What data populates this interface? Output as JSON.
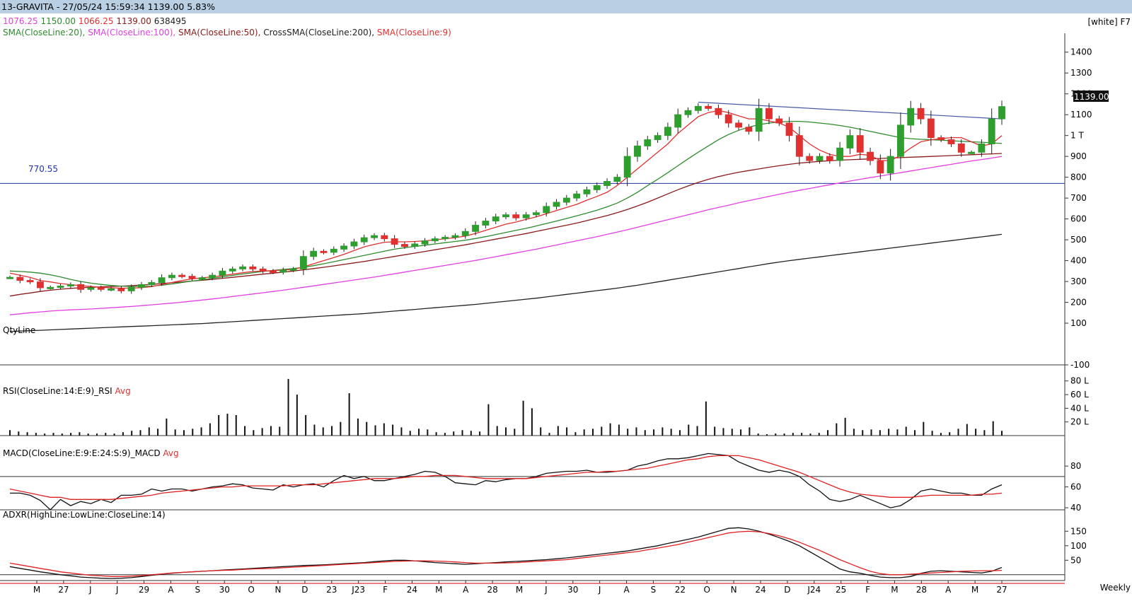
{
  "title_bar": "13-GRAVITA - 27/05/24 15:59:34 1139.00 5.83%",
  "theme_label": "[white] F7",
  "ohlc_line": {
    "open": "1076.25",
    "high": "1150.00",
    "low": "1066.25",
    "close": "1139.00",
    "volume": "638495"
  },
  "indicator_legend": [
    {
      "text": "SMA(CloseLine:20),",
      "color": "#2e8b2e"
    },
    {
      "text": "SMA(CloseLine:100),",
      "color": "#e040e0"
    },
    {
      "text": "SMA(CloseLine:50),",
      "color": "#8b1a1a"
    },
    {
      "text": "CrossSMA(CloseLine:200),",
      "color": "#222222"
    },
    {
      "text": "SMA(CloseLine:9)",
      "color": "#e03030"
    }
  ],
  "horizontal_line_label": "770.55",
  "last_price_label": "1139.00",
  "qty_label": "QtyLine",
  "rsi_label": "RSI(CloseLine:14:E:9)_RSI",
  "rsi_avg": "Avg",
  "macd_label": "MACD(CloseLine:E:9:E:24:S:9)_MACD",
  "macd_avg": "Avg",
  "adxr_label": "ADXR(HighLine:LowLine:CloseLine:14)",
  "period_label": "Weekly",
  "colors": {
    "up": "#2e9e2e",
    "down": "#e03030",
    "sma20": "#2e8b2e",
    "sma100": "#e040e0",
    "sma50": "#8b1a1a",
    "sma200": "#222222",
    "sma9": "#e03030",
    "trendline": "#4a5aa8",
    "hline": "#2233aa",
    "titlebar": "#b9cfe4"
  },
  "chart_data": [
    {
      "type": "candlestick",
      "ylim": [
        -100,
        1450
      ],
      "yticks": [
        "1400",
        "1300",
        "1200",
        "1100",
        "1 T",
        "900",
        "800",
        "700",
        "600",
        "500",
        "400",
        "300",
        "200",
        "100",
        "-100"
      ],
      "ytick_values": [
        1400,
        1300,
        1200,
        1100,
        1000,
        900,
        800,
        700,
        600,
        500,
        400,
        300,
        200,
        100,
        -100
      ],
      "xticks": [
        "M",
        "27",
        "J",
        "J",
        "29",
        "A",
        "S",
        "30",
        "O",
        "N",
        "D",
        "23",
        "J23",
        "F",
        "24",
        "M",
        "A",
        "28",
        "M",
        "J",
        "30",
        "J",
        "A",
        "S",
        "22",
        "O",
        "N",
        "24",
        "D",
        "J24",
        "25",
        "F",
        "M",
        "28",
        "A",
        "M",
        "27"
      ],
      "horizontal_line": 770.55,
      "close": [
        320,
        305,
        298,
        270,
        272,
        278,
        285,
        262,
        270,
        262,
        265,
        255,
        272,
        285,
        295,
        318,
        330,
        325,
        315,
        318,
        330,
        350,
        360,
        370,
        360,
        350,
        345,
        355,
        360,
        420,
        445,
        440,
        455,
        470,
        490,
        510,
        520,
        505,
        478,
        468,
        480,
        495,
        505,
        512,
        520,
        540,
        570,
        590,
        610,
        620,
        605,
        620,
        630,
        660,
        680,
        700,
        720,
        740,
        760,
        780,
        800,
        900,
        950,
        980,
        1000,
        1040,
        1100,
        1120,
        1140,
        1130,
        1100,
        1060,
        1040,
        1020,
        1130,
        1080,
        1060,
        1000,
        900,
        880,
        900,
        880,
        940,
        1000,
        920,
        880,
        820,
        900,
        1050,
        1130,
        1080,
        990,
        980,
        960,
        920,
        920,
        960,
        1080,
        1139
      ],
      "sma9": [
        340,
        330,
        320,
        305,
        298,
        290,
        285,
        280,
        276,
        272,
        270,
        268,
        268,
        270,
        275,
        285,
        295,
        305,
        312,
        318,
        322,
        328,
        335,
        342,
        348,
        350,
        352,
        355,
        358,
        370,
        385,
        400,
        415,
        430,
        448,
        466,
        478,
        488,
        490,
        490,
        492,
        495,
        500,
        505,
        510,
        518,
        530,
        545,
        560,
        575,
        585,
        598,
        610,
        625,
        640,
        655,
        670,
        690,
        708,
        728,
        760,
        800,
        840,
        880,
        920,
        960,
        1010,
        1050,
        1090,
        1110,
        1120,
        1110,
        1095,
        1080,
        1080,
        1070,
        1060,
        1040,
        1000,
        960,
        930,
        910,
        900,
        900,
        910,
        905,
        880,
        880,
        905,
        940,
        970,
        980,
        985,
        990,
        990,
        970,
        950,
        960,
        1000
      ],
      "sma20": [
        350,
        348,
        345,
        340,
        332,
        322,
        310,
        300,
        292,
        286,
        281,
        278,
        276,
        276,
        278,
        282,
        288,
        295,
        302,
        308,
        315,
        322,
        329,
        336,
        342,
        348,
        353,
        358,
        362,
        368,
        376,
        385,
        395,
        405,
        415,
        425,
        435,
        445,
        455,
        462,
        468,
        474,
        480,
        486,
        492,
        498,
        506,
        515,
        525,
        535,
        545,
        555,
        566,
        578,
        590,
        602,
        615,
        628,
        642,
        658,
        676,
        700,
        728,
        760,
        790,
        822,
        855,
        888,
        920,
        950,
        980,
        1005,
        1025,
        1040,
        1052,
        1060,
        1065,
        1068,
        1068,
        1065,
        1060,
        1055,
        1048,
        1040,
        1030,
        1020,
        1010,
        1000,
        990,
        985,
        982,
        980,
        978,
        975,
        972,
        970,
        968,
        965,
        962
      ],
      "sma50": [
        230,
        238,
        245,
        252,
        258,
        263,
        267,
        270,
        272,
        274,
        276,
        278,
        280,
        283,
        286,
        290,
        294,
        298,
        302,
        306,
        310,
        315,
        320,
        325,
        330,
        335,
        340,
        345,
        350,
        356,
        362,
        368,
        375,
        382,
        389,
        396,
        404,
        412,
        420,
        428,
        436,
        444,
        452,
        460,
        468,
        476,
        485,
        494,
        503,
        512,
        521,
        530,
        540,
        550,
        560,
        570,
        580,
        592,
        604,
        616,
        630,
        645,
        662,
        680,
        700,
        720,
        740,
        758,
        775,
        790,
        803,
        814,
        824,
        832,
        840,
        848,
        855,
        862,
        868,
        872,
        876,
        879,
        882,
        884,
        886,
        888,
        890,
        892,
        894,
        896,
        898,
        900,
        902,
        904,
        906,
        908,
        910,
        912,
        914
      ],
      "sma100": [
        140,
        145,
        150,
        154,
        158,
        161,
        164,
        166,
        168,
        171,
        174,
        177,
        180,
        184,
        188,
        192,
        196,
        201,
        206,
        211,
        216,
        222,
        228,
        234,
        240,
        246,
        252,
        258,
        265,
        272,
        279,
        286,
        293,
        300,
        307,
        314,
        321,
        329,
        337,
        345,
        353,
        361,
        369,
        377,
        385,
        393,
        401,
        410,
        419,
        428,
        437,
        446,
        455,
        465,
        475,
        485,
        495,
        505,
        515,
        526,
        537,
        548,
        560,
        572,
        584,
        596,
        608,
        620,
        632,
        644,
        655,
        666,
        677,
        688,
        698,
        708,
        718,
        728,
        737,
        746,
        755,
        764,
        773,
        782,
        790,
        798,
        806,
        814,
        822,
        830,
        838,
        846,
        854,
        862,
        870,
        878,
        885,
        892,
        900
      ],
      "sma200": [
        60,
        62,
        64,
        66,
        68,
        70,
        72,
        74,
        76,
        78,
        80,
        82,
        84,
        86,
        88,
        90,
        92,
        94,
        96,
        98,
        101,
        104,
        107,
        110,
        113,
        116,
        119,
        122,
        125,
        128,
        131,
        134,
        137,
        140,
        143,
        146,
        150,
        154,
        158,
        162,
        166,
        170,
        174,
        178,
        182,
        186,
        190,
        195,
        200,
        205,
        210,
        215,
        220,
        226,
        232,
        238,
        244,
        250,
        256,
        262,
        268,
        275,
        282,
        290,
        298,
        306,
        314,
        322,
        330,
        338,
        346,
        354,
        362,
        370,
        378,
        386,
        393,
        400,
        406,
        412,
        418,
        424,
        430,
        436,
        442,
        448,
        454,
        460,
        466,
        472,
        478,
        484,
        490,
        496,
        502,
        508,
        514,
        520,
        526
      ],
      "trendline": [
        [
          68,
          1160
        ],
        [
          98,
          1080
        ]
      ]
    },
    {
      "type": "bar",
      "name": "",
      "ylim": [
        0,
        88
      ],
      "yticks": [
        "80 L",
        "60 L",
        "40 L",
        "20 L"
      ],
      "ytick_values": [
        80,
        60,
        40,
        20
      ],
      "values": [
        8,
        6,
        5,
        4,
        3,
        4,
        3,
        4,
        5,
        3,
        3,
        4,
        3,
        5,
        7,
        8,
        12,
        10,
        25,
        9,
        8,
        10,
        12,
        18,
        30,
        32,
        30,
        14,
        8,
        11,
        14,
        13,
        83,
        60,
        30,
        16,
        12,
        14,
        20,
        62,
        25,
        20,
        15,
        18,
        16,
        12,
        7,
        10,
        9,
        5,
        4,
        6,
        8,
        7,
        6,
        46,
        14,
        12,
        10,
        51,
        40,
        12,
        4,
        14,
        12,
        5,
        9,
        10,
        13,
        18,
        16,
        10,
        12,
        8,
        9,
        12,
        10,
        8,
        16,
        14,
        50,
        13,
        11,
        10,
        9,
        12,
        3,
        2,
        3,
        3,
        4,
        4,
        3,
        4,
        8,
        18,
        26,
        10,
        8,
        9,
        8,
        10,
        9,
        13,
        8,
        20,
        7,
        4,
        5,
        10,
        17,
        10,
        8,
        21,
        7
      ]
    },
    {
      "type": "line",
      "ylim": [
        38,
        95
      ],
      "yticks": [
        "80",
        "60",
        "40"
      ],
      "ytick_values": [
        80,
        60,
        40
      ],
      "reference_line": 70,
      "series": [
        {
          "values": [
            54,
            54,
            52,
            47,
            38,
            48,
            42,
            46,
            44,
            48,
            45,
            52,
            52,
            53,
            58,
            56,
            58,
            58,
            56,
            58,
            60,
            61,
            63,
            62,
            59,
            58,
            57,
            62,
            60,
            62,
            63,
            60,
            66,
            71,
            68,
            70,
            66,
            66,
            68,
            70,
            72,
            75,
            74,
            70,
            64,
            63,
            62,
            66,
            65,
            67,
            68,
            68,
            70,
            73,
            74,
            75,
            75,
            76,
            74,
            74,
            75,
            76,
            80,
            82,
            85,
            87,
            87,
            88,
            90,
            92,
            91,
            90,
            84,
            80,
            76,
            74,
            76,
            74,
            70,
            62,
            56,
            48,
            46,
            48,
            52,
            48,
            44,
            40,
            42,
            48,
            56,
            58,
            56,
            54,
            54,
            52,
            52,
            58,
            62
          ]
        },
        {
          "values": [
            58,
            56,
            54,
            52,
            50,
            50,
            48,
            48,
            48,
            48,
            48,
            49,
            50,
            51,
            52,
            54,
            55,
            56,
            57,
            58,
            59,
            60,
            60,
            61,
            61,
            61,
            61,
            61,
            62,
            62,
            62,
            63,
            64,
            65,
            66,
            67,
            68,
            68,
            68,
            69,
            70,
            70,
            71,
            71,
            71,
            70,
            69,
            68,
            68,
            68,
            68,
            68,
            69,
            70,
            71,
            72,
            73,
            74,
            74,
            75,
            75,
            76,
            77,
            78,
            80,
            82,
            84,
            86,
            87,
            89,
            90,
            90,
            90,
            88,
            86,
            83,
            80,
            77,
            74,
            70,
            66,
            62,
            58,
            55,
            53,
            52,
            51,
            50,
            50,
            50,
            51,
            52,
            52,
            52,
            52,
            52,
            53,
            53,
            54
          ]
        }
      ]
    },
    {
      "type": "line",
      "ylim": [
        -20,
        175
      ],
      "yticks": [
        "150",
        "100",
        "50"
      ],
      "ytick_values": [
        150,
        100,
        50
      ],
      "reference_line": 0,
      "series": [
        {
          "values": [
            28,
            22,
            16,
            10,
            5,
            0,
            -4,
            -8,
            -10,
            -12,
            -13,
            -12,
            -10,
            -6,
            -2,
            2,
            5,
            8,
            10,
            12,
            14,
            16,
            18,
            20,
            22,
            24,
            26,
            28,
            30,
            32,
            33,
            34,
            36,
            38,
            40,
            42,
            45,
            48,
            50,
            50,
            48,
            45,
            42,
            40,
            38,
            36,
            38,
            40,
            42,
            44,
            46,
            48,
            50,
            52,
            55,
            58,
            62,
            66,
            70,
            74,
            78,
            82,
            88,
            94,
            100,
            108,
            115,
            122,
            130,
            140,
            150,
            160,
            162,
            158,
            150,
            140,
            128,
            115,
            100,
            80,
            60,
            40,
            20,
            10,
            5,
            -2,
            -8,
            -10,
            -10,
            -6,
            5,
            12,
            14,
            12,
            10,
            8,
            6,
            12,
            25
          ]
        },
        {
          "values": [
            40,
            34,
            28,
            22,
            16,
            10,
            6,
            2,
            -2,
            -4,
            -6,
            -6,
            -5,
            -3,
            0,
            3,
            6,
            8,
            10,
            12,
            14,
            15,
            16,
            18,
            20,
            21,
            22,
            24,
            26,
            28,
            30,
            32,
            34,
            36,
            38,
            40,
            42,
            44,
            46,
            47,
            48,
            48,
            47,
            46,
            44,
            42,
            40,
            40,
            40,
            41,
            42,
            44,
            46,
            48,
            50,
            52,
            56,
            60,
            64,
            68,
            72,
            76,
            80,
            86,
            92,
            98,
            104,
            112,
            120,
            128,
            136,
            144,
            148,
            150,
            148,
            142,
            134,
            124,
            112,
            98,
            84,
            68,
            52,
            38,
            24,
            12,
            4,
            0,
            0,
            2,
            4,
            6,
            8,
            10,
            12,
            13,
            14,
            14,
            15
          ]
        }
      ]
    }
  ]
}
